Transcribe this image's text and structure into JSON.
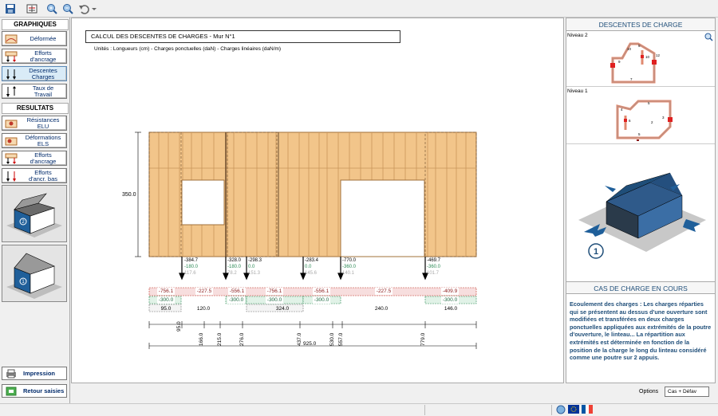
{
  "toolbar": {
    "icons": [
      "save-icon",
      "diagram-icon",
      "zoom-in-icon",
      "zoom-out-icon",
      "undo-icon",
      "dropdown-icon"
    ]
  },
  "left": {
    "graphiques_title": "GRAPHIQUES",
    "btn_deformee": "Déformée",
    "btn_efforts_ancrage": "Efforts\nd'ancrage",
    "btn_descentes": "Descentes\nCharges",
    "btn_taux": "Taux de\nTravail",
    "resultats_title": "RESULTATS",
    "btn_resistances": "Résistances\nELU",
    "btn_deformations": "Déformations\nELS",
    "btn_efforts_ancrage2": "Efforts\nd'ancrage",
    "btn_efforts_bas": "Efforts\nd'ancr. bas",
    "level_top_label": "2",
    "level_bottom_label": "1",
    "btn_impression": "Impression",
    "btn_retour": "Retour saisies"
  },
  "main": {
    "title": "CALCUL DES DESCENTES DE CHARGES - Mur N°1",
    "units": "Unités : Longueurs (cm) -  Charges ponctuelles (daN) -  Charges linéaires (daN/m)",
    "height_label": "350.0",
    "point_loads": [
      {
        "v1": "-384.7",
        "v2": "-180.0",
        "v3": "117.6"
      },
      {
        "v1": "-328.0",
        "v2": "-180.0",
        "v3": "78.2"
      },
      {
        "v1": "-298.3",
        "v2": "0.0",
        "v3": "151.3"
      },
      {
        "v1": "-283.4",
        "v2": "0.0",
        "v3": "145.6"
      },
      {
        "v1": "-770.0",
        "v2": "-360.0",
        "v3": "140.1"
      },
      {
        "v1": "-469.7",
        "v2": "-360.0",
        "v3": "101.7"
      }
    ],
    "line_loads_red": [
      "-756.1",
      "-227.5",
      "-556.1",
      "-756.1",
      "-556.1",
      "-227.5",
      "-409.9"
    ],
    "line_loads_green": [
      "-300.0",
      "-300.0",
      "-300.0",
      "-300.0",
      "-300.0"
    ],
    "segment_lengths": [
      "95.0",
      "120.0",
      "324.0",
      "240.0",
      "146.0"
    ],
    "positions": [
      "95.0",
      "166.0",
      "215.0",
      "276.0",
      "437.0",
      "530.0",
      "557.0",
      "779.0"
    ],
    "total_length": "925.0"
  },
  "right": {
    "header": "DESCENTES DE CHARGE",
    "niveau2": "Niveau 2",
    "niveau1": "Niveau 1",
    "n2_labels": [
      "5",
      "10",
      "9",
      "10",
      "12",
      "7"
    ],
    "n1_labels": [
      "4",
      "5",
      "6",
      "3",
      "5",
      "2"
    ],
    "house_number": "1",
    "cas_header": "CAS DE CHARGE EN COURS",
    "cas_text": "Ecoulement des charges : Les charges réparties qui se présentent au dessus d'une ouverture sont modifiées et transférées en deux charges ponctuelles appliquées aux extrémités de la poutre d'ouverture, le linteau... La répartition aux extrémités est déterminée en fonction de la position de la charge le long du linteau considéré comme une poutre sur 2 appuis.",
    "options_label": "Options",
    "options_value": "Cas + Défav"
  },
  "colors": {
    "wood": "#f2c58a",
    "wood_dark": "#c8955a",
    "title_blue": "#1f4e79",
    "load_red": "#c0392b",
    "load_green": "#2e8b57"
  }
}
